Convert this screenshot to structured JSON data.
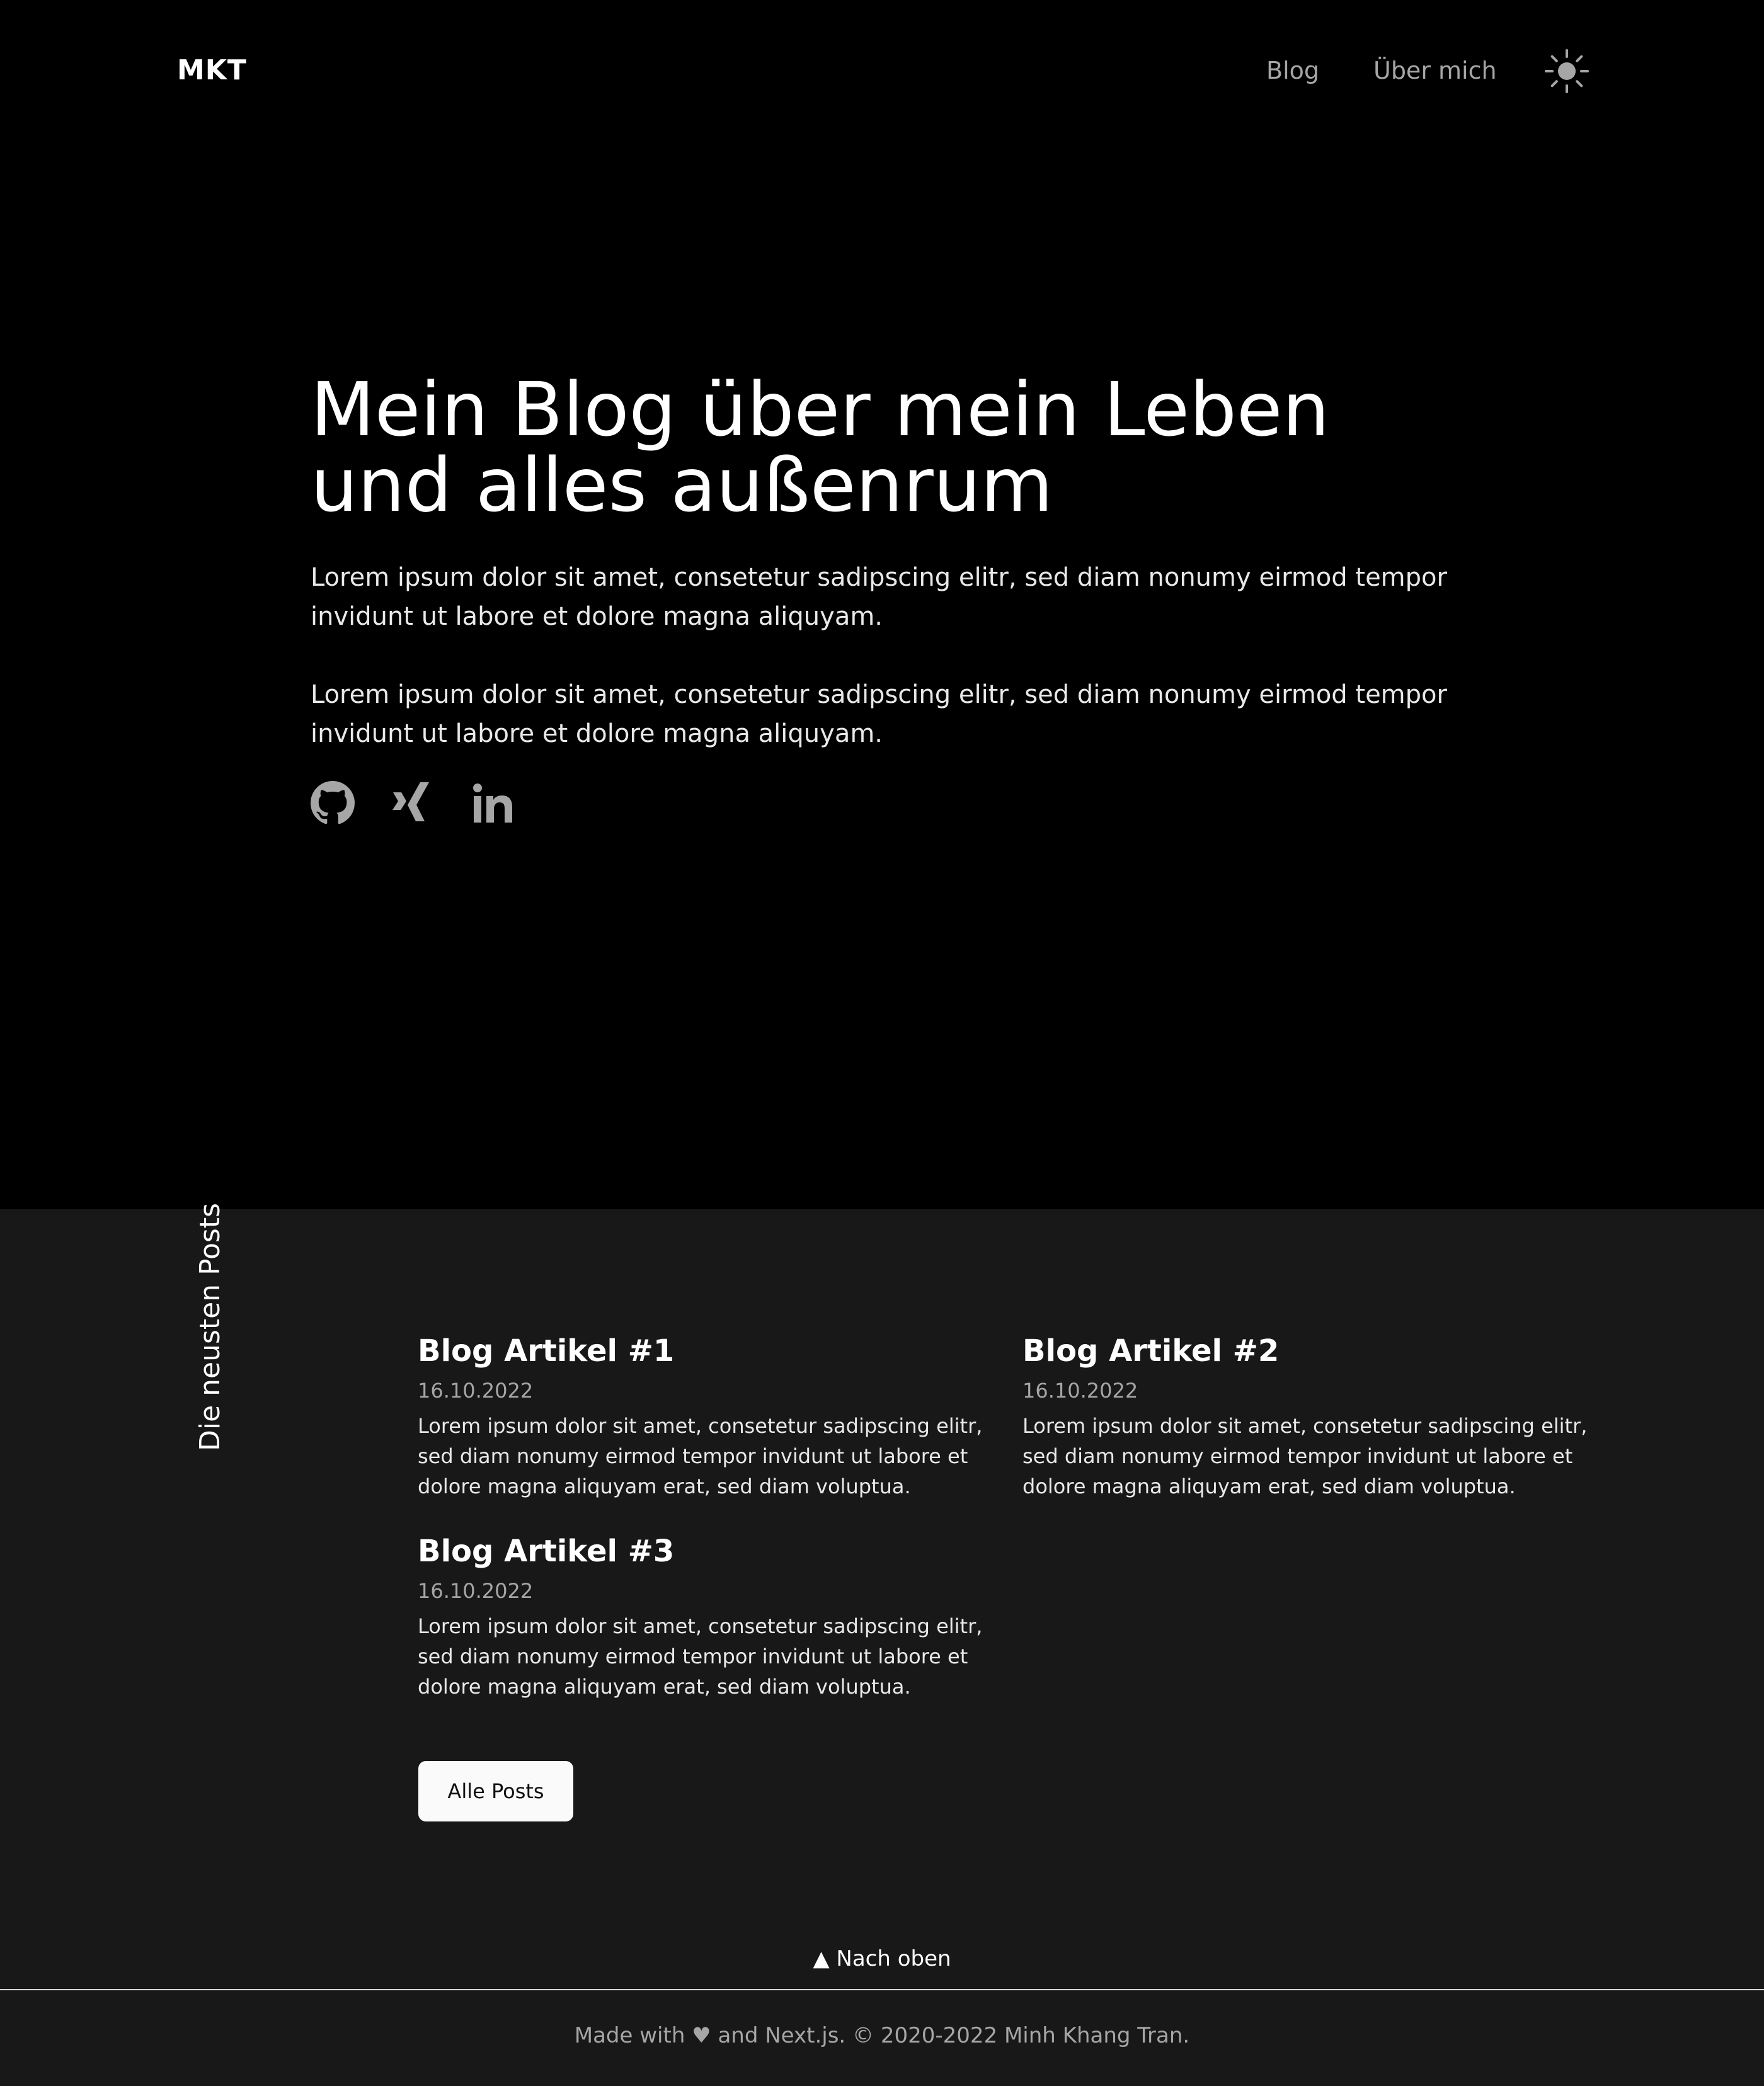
{
  "header": {
    "logo": "MKT",
    "nav": [
      {
        "label": "Blog"
      },
      {
        "label": "Über mich"
      }
    ],
    "theme_toggle_icon": "sun-icon"
  },
  "hero": {
    "title_line_1": "Mein Blog über mein Leben",
    "title_line_2": "und alles außenrum",
    "paragraphs": [
      "Lorem ipsum dolor sit amet, consetetur sadipscing elitr, sed diam nonumy eirmod tempor invidunt ut labore et dolore magna aliquyam.",
      "Lorem ipsum dolor sit amet, consetetur sadipscing elitr, sed diam nonumy eirmod tempor invidunt ut labore et dolore magna aliquyam."
    ],
    "social_icons": [
      "github-icon",
      "xing-icon",
      "linkedin-icon"
    ]
  },
  "posts": {
    "section_label": "Die neusten Posts",
    "items": [
      {
        "title": "Blog Artikel #1",
        "date": "16.10.2022",
        "excerpt": "Lorem ipsum dolor sit amet, consetetur sadipscing elitr, sed diam nonumy eirmod tempor invidunt ut labore et dolore magna aliquyam erat, sed diam voluptua."
      },
      {
        "title": "Blog Artikel #2",
        "date": "16.10.2022",
        "excerpt": "Lorem ipsum dolor sit amet, consetetur sadipscing elitr, sed diam nonumy eirmod tempor invidunt ut labore et dolore magna aliquyam erat, sed diam voluptua."
      },
      {
        "title": "Blog Artikel #3",
        "date": "16.10.2022",
        "excerpt": "Lorem ipsum dolor sit amet, consetetur sadipscing elitr, sed diam nonumy eirmod tempor invidunt ut labore et dolore magna aliquyam erat, sed diam voluptua."
      }
    ],
    "all_posts_label": "Alle Posts"
  },
  "footer": {
    "back_to_top": "▲ Nach oben",
    "credit": "Made with ♥ and Next.js. © 2020-2022 Minh Khang Tran."
  },
  "colors": {
    "hero_background": "#000000",
    "section_background": "#181818",
    "muted_text": "#a6a6a6",
    "button_background": "#fafafa"
  }
}
